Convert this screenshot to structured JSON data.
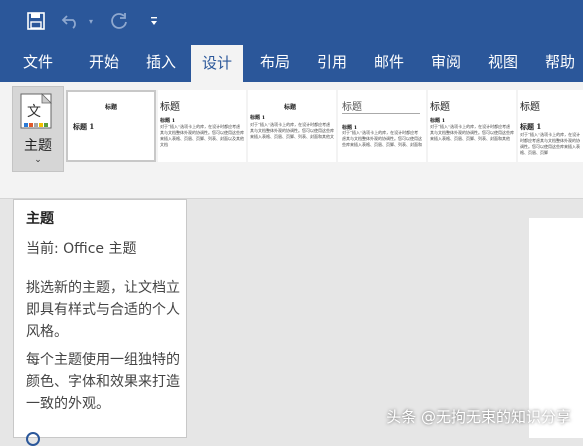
{
  "qat": {
    "save_icon": "save-icon",
    "undo_icon": "undo-icon",
    "redo_icon": "redo-icon",
    "customize_icon": "customize-icon"
  },
  "tabs": [
    {
      "label": "文件"
    },
    {
      "label": "开始"
    },
    {
      "label": "插入"
    },
    {
      "label": "设计",
      "active": true
    },
    {
      "label": "布局"
    },
    {
      "label": "引用"
    },
    {
      "label": "邮件"
    },
    {
      "label": "审阅"
    },
    {
      "label": "视图"
    },
    {
      "label": "帮助"
    }
  ],
  "ribbon": {
    "theme_button_label": "主题",
    "theme_icon_text": "文",
    "gallery": [
      {
        "title": "标题",
        "heading": "标题 1",
        "body": "对于“插入”选项卡上的库，在设计时都应考虑其与文档整体外观的协调性。您可以使用这些库来插入表格、页眉、页脚、列表和其他"
      },
      {
        "title": "标题",
        "heading": "标题 1",
        "body": "对于“插入”选项卡上的库，在设计时都应考虑其与文档整体外观的协调性。您可以使用这些库来插入表格、页眉、页脚、列表、封面以及其他文档"
      },
      {
        "title": "标题",
        "heading": "标题 1",
        "body": "对于“插入”选项卡上的库，在设计时都应考虑其与文档整体外观的协调性。您可以使用这些库来插入表格、页眉、页脚、列表、封面和其他文"
      },
      {
        "title": "标题",
        "heading": "标题 1",
        "body": "对于“插入”选项卡上的库，在设计时都应考虑其与文档整体外观的协调性。您可以使用这些库来插入表格、页眉、页脚、列表、封面和"
      },
      {
        "title": "标题",
        "heading": "标题 1",
        "body": "对于“插入”选项卡上的库，在设计时都应考虑其与文档整体外观的协调性。您可以使用这些库来插入表格、页眉、页脚、列表、封面和其他"
      },
      {
        "title": "标题",
        "heading": "标题 1",
        "body": "对于“插入”选项卡上的库，在设计时都应考虑其与文档整体外观的协调性。您可以使用这些库来插入表格、页眉、页脚"
      }
    ]
  },
  "tooltip": {
    "title": "主题",
    "current": "当前: Office 主题",
    "para1": "挑选新的主题，让文档立即具有样式与合适的个人风格。",
    "para2": "每个主题使用一组独特的颜色、字体和效果来打造一致的外观。"
  },
  "watermark": "头条 @无拘无束的知识分享",
  "colors": {
    "accent": "#2b579a",
    "ribbon": "#f3f3f3",
    "canvas": "#e6e6e6"
  }
}
